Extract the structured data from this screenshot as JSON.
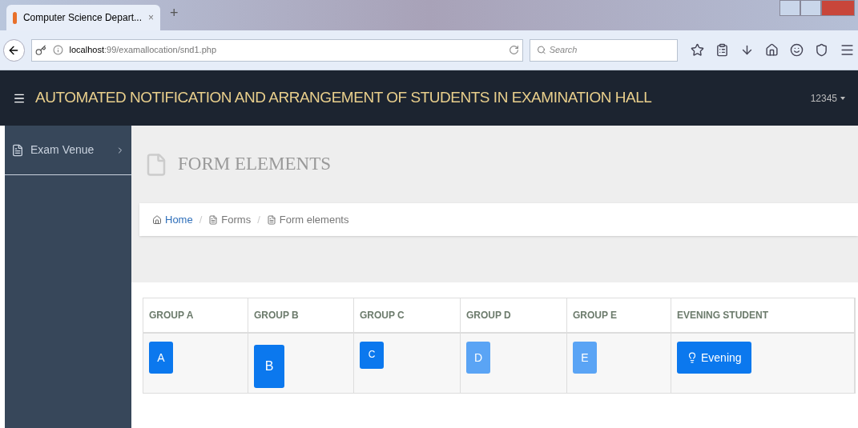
{
  "browser": {
    "tab_title": "Computer Science Depart...",
    "tab_close": "×",
    "new_tab": "+",
    "url_host": "localhost",
    "url_path": ":99/examallocation/snd1.php",
    "search": {
      "placeholder": "Search"
    }
  },
  "header": {
    "title": "AUTOMATED NOTIFICATION AND ARRANGEMENT OF STUDENTS IN EXAMINATION HALL",
    "user": "12345"
  },
  "sidebar": {
    "items": [
      {
        "label": "Exam Venue",
        "selected": false
      }
    ]
  },
  "page_title": "FORM ELEMENTS",
  "breadcrumb_separator": "/",
  "breadcrumb": [
    {
      "label": "Home",
      "kind": "link"
    },
    {
      "label": "Forms",
      "kind": "text"
    },
    {
      "label": "Form elements",
      "kind": "text"
    }
  ],
  "table": {
    "columns": [
      "GROUP A",
      "GROUP B",
      "GROUP C",
      "GROUP D",
      "GROUP E",
      "EVENING STUDENT"
    ],
    "buttons": [
      {
        "label": "A",
        "kind": "medium",
        "disabled": false
      },
      {
        "label": "B",
        "kind": "large",
        "disabled": false
      },
      {
        "label": "C",
        "kind": "small",
        "disabled": false
      },
      {
        "label": "D",
        "kind": "medium",
        "disabled": true
      },
      {
        "label": "E",
        "kind": "medium",
        "disabled": true
      },
      {
        "label": "Evening",
        "kind": "wide",
        "disabled": false
      }
    ]
  }
}
